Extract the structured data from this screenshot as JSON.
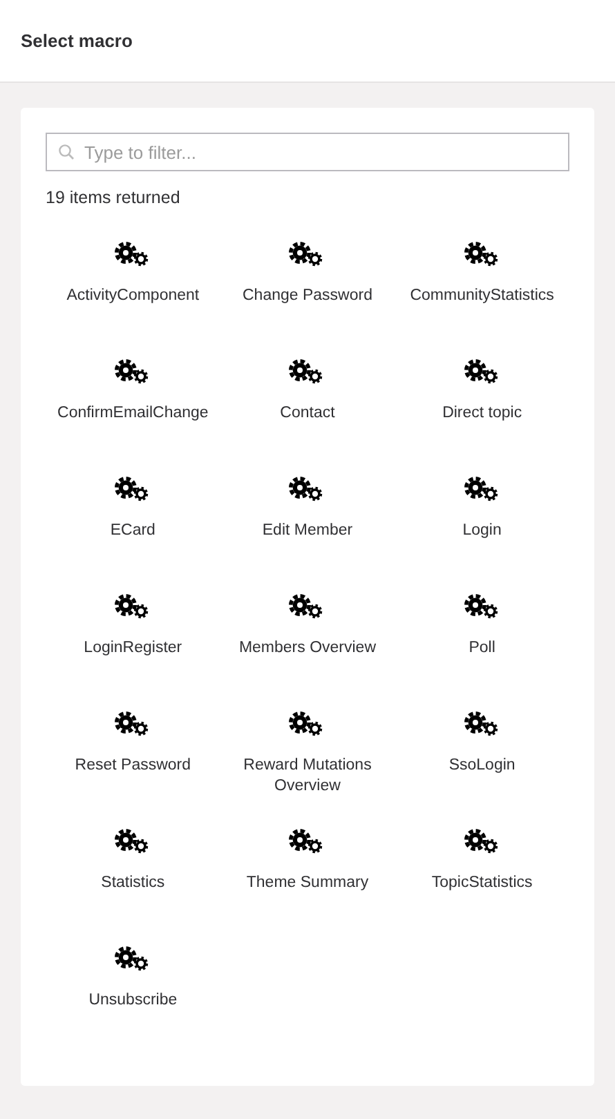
{
  "title": "Select macro",
  "filter": {
    "placeholder": "Type to filter..."
  },
  "count": "19 items returned",
  "macros": [
    {
      "label": "ActivityComponent"
    },
    {
      "label": "Change Password"
    },
    {
      "label": "CommunityStatistics"
    },
    {
      "label": "ConfirmEmailChange"
    },
    {
      "label": "Contact"
    },
    {
      "label": "Direct topic"
    },
    {
      "label": "ECard"
    },
    {
      "label": "Edit Member"
    },
    {
      "label": "Login"
    },
    {
      "label": "LoginRegister"
    },
    {
      "label": "Members Overview"
    },
    {
      "label": "Poll"
    },
    {
      "label": "Reset Password"
    },
    {
      "label": "Reward Mutations Overview"
    },
    {
      "label": "SsoLogin"
    },
    {
      "label": "Statistics"
    },
    {
      "label": "Theme Summary"
    },
    {
      "label": "TopicStatistics"
    },
    {
      "label": "Unsubscribe"
    }
  ]
}
